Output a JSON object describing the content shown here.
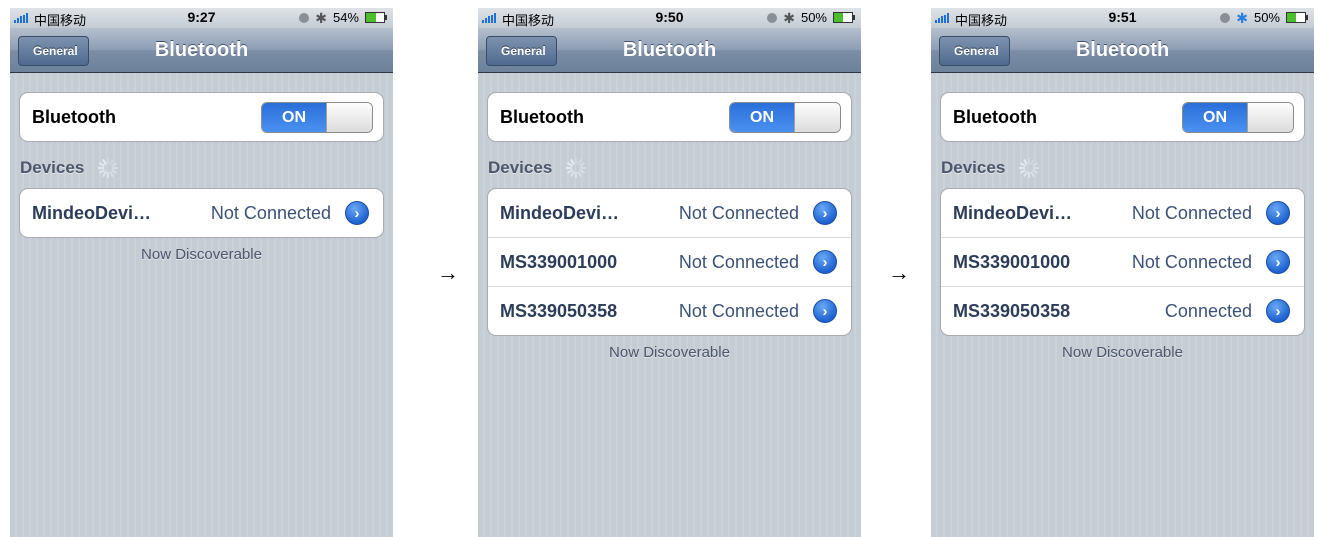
{
  "colors": {
    "background_stripes": "#c5ccd4",
    "nav_bar": "#7c8ea6",
    "toggle_on": "#2a6fd8",
    "device_name": "#2c3d5a",
    "device_status": "#3b5277",
    "bluetooth_active": "#2a7ee0"
  },
  "arrows": [
    "→",
    "→"
  ],
  "screens": [
    {
      "status": {
        "carrier": "中国移动",
        "time": "9:27",
        "battery": "54%",
        "battery_level": 0.54,
        "bt_active": false
      },
      "nav": {
        "back": "General",
        "title": "Bluetooth"
      },
      "bluetooth": {
        "label": "Bluetooth",
        "toggle": "ON"
      },
      "devices_header": "Devices",
      "devices": [
        {
          "name": "MindeoDevi…",
          "status": "Not Connected"
        }
      ],
      "footer": "Now Discoverable"
    },
    {
      "status": {
        "carrier": "中国移动",
        "time": "9:50",
        "battery": "50%",
        "battery_level": 0.5,
        "bt_active": false
      },
      "nav": {
        "back": "General",
        "title": "Bluetooth"
      },
      "bluetooth": {
        "label": "Bluetooth",
        "toggle": "ON"
      },
      "devices_header": "Devices",
      "devices": [
        {
          "name": "MindeoDevi…",
          "status": "Not Connected"
        },
        {
          "name": "MS339001000",
          "status": "Not Connected"
        },
        {
          "name": "MS339050358",
          "status": "Not Connected"
        }
      ],
      "footer": "Now Discoverable"
    },
    {
      "status": {
        "carrier": "中国移动",
        "time": "9:51",
        "battery": "50%",
        "battery_level": 0.5,
        "bt_active": true
      },
      "nav": {
        "back": "General",
        "title": "Bluetooth"
      },
      "bluetooth": {
        "label": "Bluetooth",
        "toggle": "ON"
      },
      "devices_header": "Devices",
      "devices": [
        {
          "name": "MindeoDevi…",
          "status": "Not Connected"
        },
        {
          "name": "MS339001000",
          "status": "Not Connected"
        },
        {
          "name": "MS339050358",
          "status": "Connected"
        }
      ],
      "footer": "Now Discoverable"
    }
  ]
}
